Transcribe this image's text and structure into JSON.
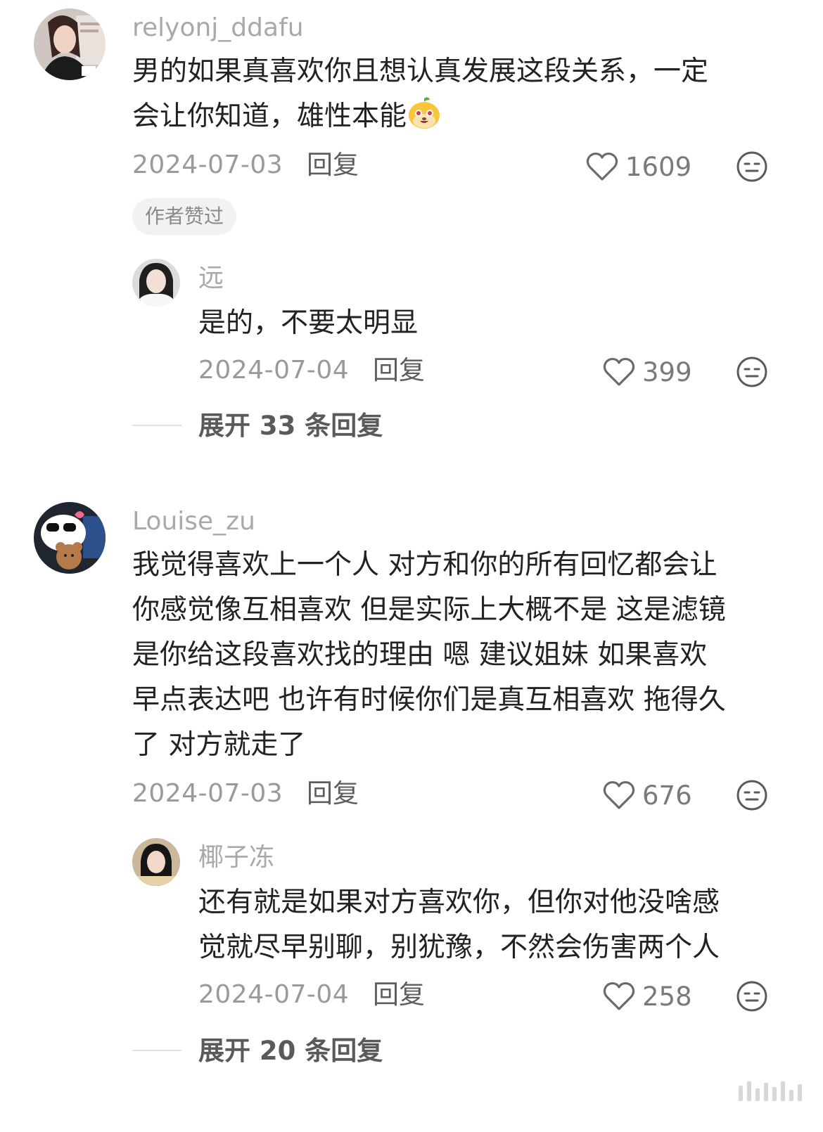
{
  "comments": [
    {
      "username": "relyonj_ddafu",
      "content_lines": [
        "男的如果真喜欢你且想认真发展这段关系，一定",
        "会让你知道，雄性本能"
      ],
      "emoji_icon": "grinning-mango-sticker-icon",
      "date": "2024-07-03",
      "reply_label": "回复",
      "likes": "1609",
      "badge": "作者赞过",
      "replies": [
        {
          "username": "远",
          "content_lines": [
            "是的，不要太明显"
          ],
          "date": "2024-07-04",
          "reply_label": "回复",
          "likes": "399"
        }
      ],
      "expand_label": "展开 33 条回复"
    },
    {
      "username": "Louise_zu",
      "content_lines": [
        "我觉得喜欢上一个人 对方和你的所有回忆都会让",
        "你感觉像互相喜欢 但是实际上大概不是 这是滤镜",
        "是你给这段喜欢找的理由 嗯 建议姐妹 如果喜欢",
        "早点表达吧 也许有时候你们是真互相喜欢 拖得久",
        "了 对方就走了"
      ],
      "date": "2024-07-03",
      "reply_label": "回复",
      "likes": "676",
      "replies": [
        {
          "username": "椰子冻",
          "content_lines": [
            "还有就是如果对方喜欢你，但你对他没啥感",
            "觉就尽早别聊，别犹豫，不然会伤害两个人"
          ],
          "date": "2024-07-04",
          "reply_label": "回复",
          "likes": "258"
        }
      ],
      "expand_label": "展开 20 条回复"
    }
  ],
  "icons": {
    "like": "heart-outline-icon",
    "dislike": "neutral-face-icon"
  }
}
